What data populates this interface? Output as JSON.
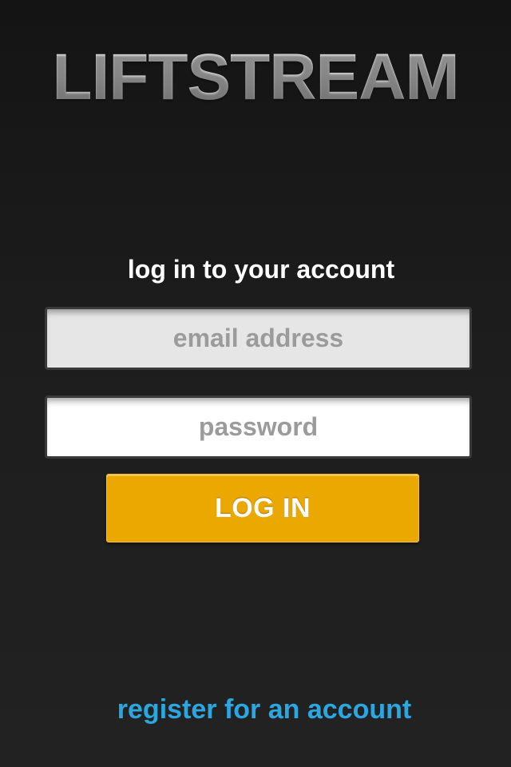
{
  "app": {
    "logo_text": "LIFTSTREAM"
  },
  "login": {
    "heading": "log in to your account",
    "email_placeholder": "email address",
    "email_value": "",
    "password_placeholder": "password",
    "password_value": "",
    "submit_label": "LOG IN"
  },
  "footer": {
    "register_label": "register for an account"
  },
  "colors": {
    "background": "#1b1b1b",
    "accent_button": "#eba800",
    "link": "#2aa7e0",
    "logo": "#c9c9c9"
  }
}
